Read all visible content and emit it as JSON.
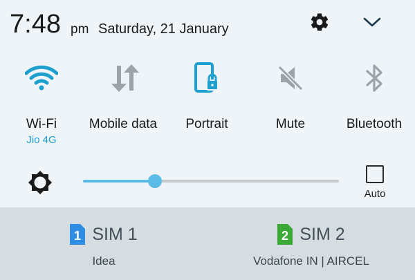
{
  "status": {
    "time": "7:48",
    "ampm": "pm",
    "date": "Saturday, 21 January",
    "settings_icon": "gear-icon",
    "expand_icon": "chevron-down-icon"
  },
  "toggles": [
    {
      "label": "Wi-Fi",
      "sub": "Jio 4G",
      "icon": "wifi-icon",
      "active": true
    },
    {
      "label": "Mobile data",
      "sub": "",
      "icon": "mobile-data-icon",
      "active": false
    },
    {
      "label": "Portrait",
      "sub": "",
      "icon": "portrait-lock-icon",
      "active": true
    },
    {
      "label": "Mute",
      "sub": "",
      "icon": "mute-icon",
      "active": false
    },
    {
      "label": "Bluetooth",
      "sub": "",
      "icon": "bluetooth-icon",
      "active": false
    }
  ],
  "brightness": {
    "icon": "brightness-icon",
    "level": 0.28,
    "auto_label": "Auto",
    "auto_checked": false
  },
  "sims": [
    {
      "number": "1",
      "name": "SIM 1",
      "operator": "Idea",
      "color": "#2f8de4"
    },
    {
      "number": "2",
      "name": "SIM 2",
      "operator": "Vodafone IN | AIRCEL",
      "color": "#3aa935"
    }
  ],
  "colors": {
    "accent": "#1fa1d0",
    "inactive": "#9aa4aa"
  }
}
